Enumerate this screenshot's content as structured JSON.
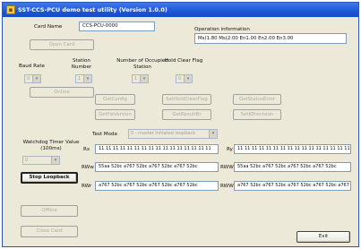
{
  "window": {
    "title": "SST-CCS-PCU demo test utility (Version 1.0.0)"
  },
  "card": {
    "name_label": "Card Name",
    "name_value": "CCS-PCU-0000",
    "open_button": "Open Card",
    "operation_label": "Operation information",
    "operation_value": "Ms(1.80 Ms(2.00 En1.00 En2.00 En3.00"
  },
  "settings": {
    "baud_rate_label": "Baud Rate",
    "station_number_label": "Station Number",
    "occupied_label": "Number of Occupied Station",
    "hold_clear_label": "Hold Clear Flag",
    "baud_rate_value": "0",
    "station_number_value": "1",
    "occupied_value": "1",
    "hold_clear_value": "0",
    "online_button": "Online"
  },
  "functions": {
    "get_config": "GetConfig",
    "set_hold_clear_flag": "SetHoldClearFlag",
    "get_status_error": "GetStatusError",
    "get_fw_version": "GetFwVersion",
    "get_result": "GetResultBr",
    "set_k_precision": "SetKPrecision"
  },
  "watchdog": {
    "label": "Watchdog Timer Value (100ms)",
    "value": "0"
  },
  "test": {
    "mode_label": "Test Mode",
    "mode_value": "0 - master initiated loopback",
    "stop_button": "Stop Loopback",
    "rx_label": "Rx",
    "rx_value": "11 11 11 11 11 11 11 11 11 11 11 11 11 11 11 11",
    "ry_label": "Ry",
    "ry_value": "11 11 11 11 11 11 11 11 11 11 11 11 11 11 11 11",
    "rww_label": "RWw",
    "rww_value": "55aa 52bc a767 52bc a767 52bc a767 52bc",
    "rwr_label": "RWr",
    "rwr_value": "a767 52bc a767 52bc a767 52bc a767 52bc",
    "rww2_label": "RWW",
    "rww2_value": "55aa 52bc a767 52bc a767 52bc a767 52bc",
    "rwr2_label": "RWW",
    "rwr2_value": "a767 52bc a767 52bc a767 52bc a767 52bc a767"
  },
  "bottom": {
    "offline_button": "Offline",
    "close_button": "Close Card",
    "exit_button": "Exit"
  }
}
